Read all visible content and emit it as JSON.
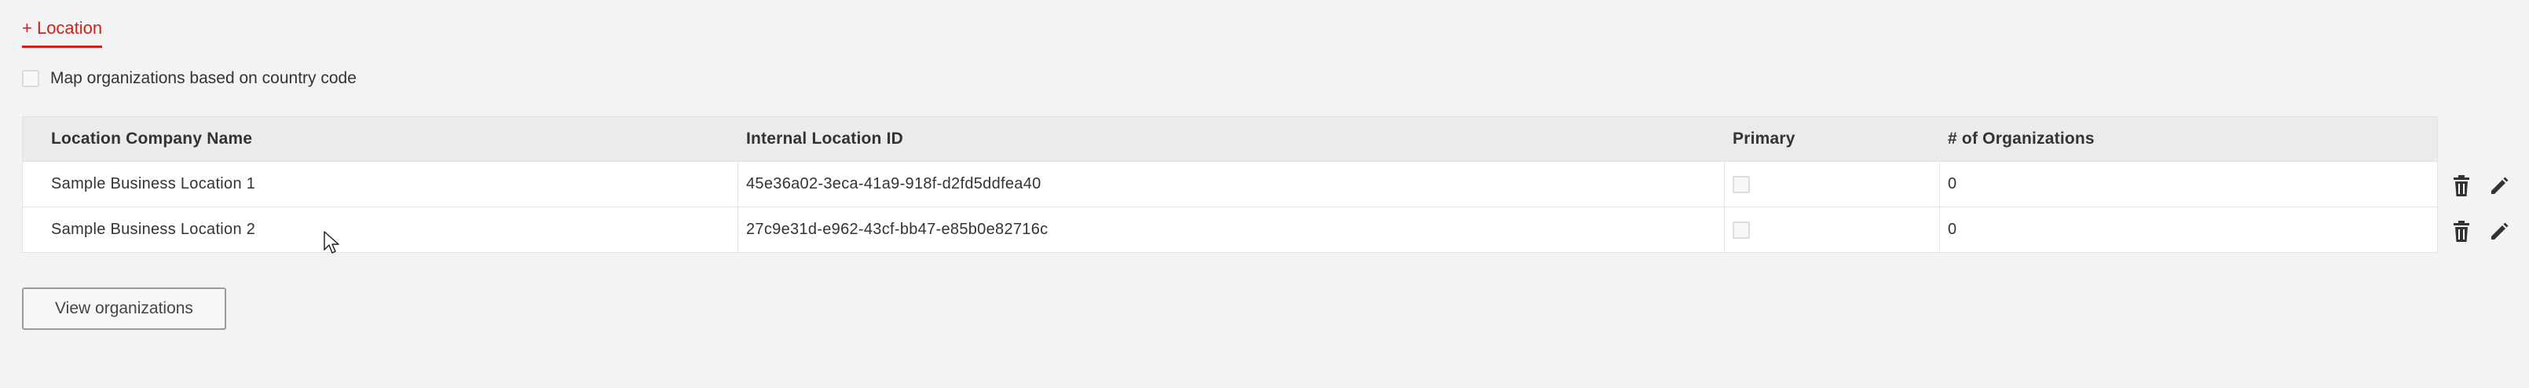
{
  "add_location": {
    "label": "+ Location"
  },
  "map_option": {
    "label": "Map organizations based on country code",
    "checked": false
  },
  "table": {
    "headers": [
      "Location Company Name",
      "Internal Location ID",
      "Primary",
      "# of Organizations"
    ],
    "rows": [
      {
        "name": "Sample Business Location 1",
        "id": "45e36a02-3eca-41a9-918f-d2fd5ddfea40",
        "primary": false,
        "org_count": "0"
      },
      {
        "name": "Sample Business Location 2",
        "id": "27c9e31d-e962-43cf-bb47-e85b0e82716c",
        "primary": false,
        "org_count": "0"
      }
    ]
  },
  "icons": {
    "delete": "trash-icon",
    "edit": "pencil-icon"
  },
  "view_button": {
    "label": "View organizations"
  },
  "colors": {
    "accent": "#d0211c",
    "background": "#f3f3f3",
    "header": "#ebebeb"
  }
}
